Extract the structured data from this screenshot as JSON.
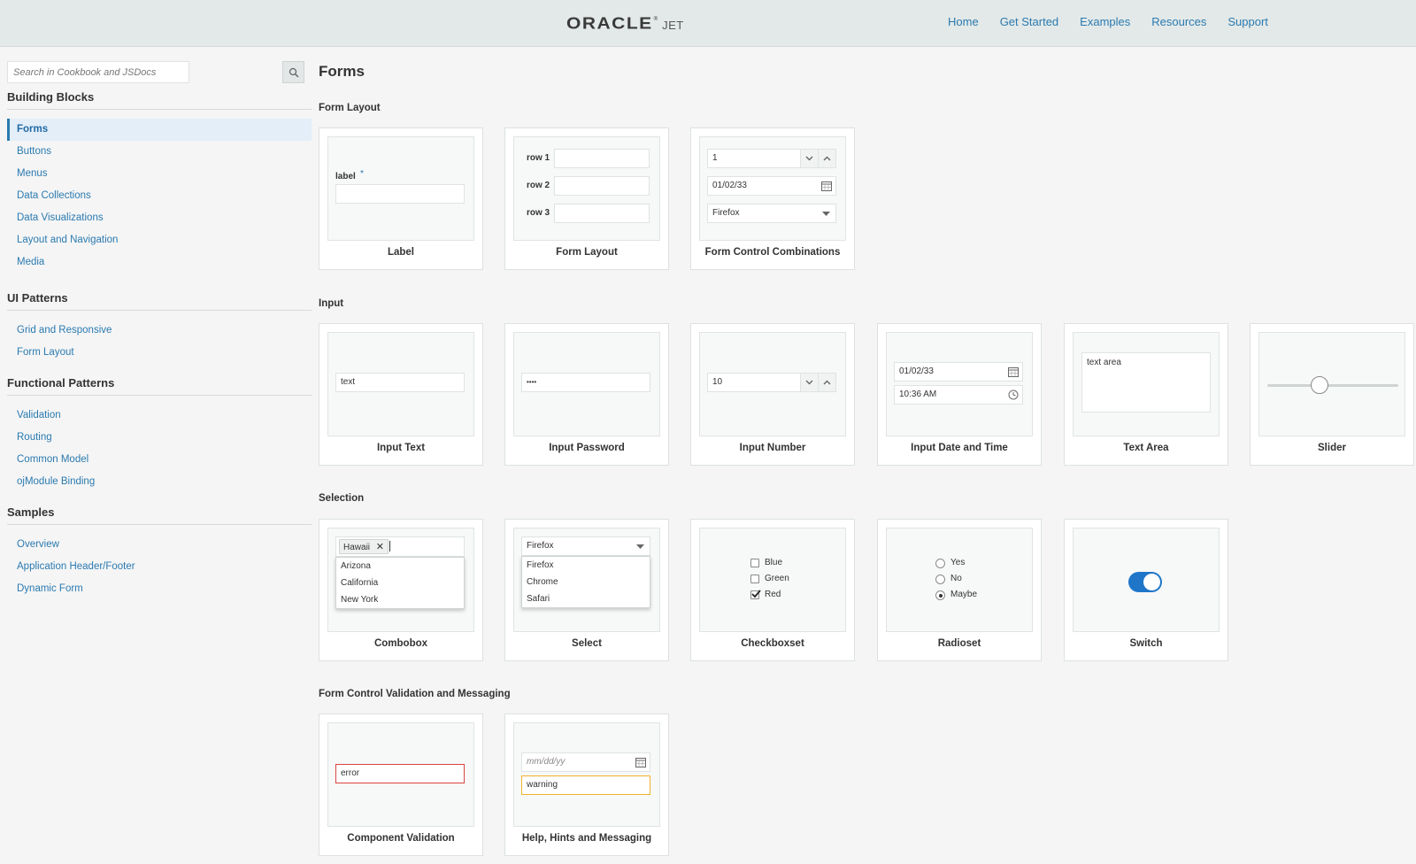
{
  "header": {
    "logo_main": "ORACLE",
    "logo_sub": "JET",
    "logo_reg": "®",
    "nav": [
      "Home",
      "Get Started",
      "Examples",
      "Resources",
      "Support"
    ]
  },
  "sidebar": {
    "search_placeholder": "Search in Cookbook and JSDocs",
    "groups": [
      {
        "title": "Building Blocks",
        "items": [
          "Forms",
          "Buttons",
          "Menus",
          "Data Collections",
          "Data Visualizations",
          "Layout and Navigation",
          "Media"
        ]
      },
      {
        "title": "UI Patterns",
        "items": [
          "Grid and Responsive",
          "Form Layout"
        ]
      },
      {
        "title": "Functional Patterns",
        "items": [
          "Validation",
          "Routing",
          "Common Model",
          "ojModule Binding"
        ]
      },
      {
        "title": "Samples",
        "items": [
          "Overview",
          "Application Header/Footer",
          "Dynamic Form"
        ]
      }
    ],
    "active_item": "Forms"
  },
  "main": {
    "title": "Forms",
    "sections": {
      "form_layout": "Form Layout",
      "input": "Input",
      "selection": "Selection",
      "validation": "Form Control Validation and Messaging"
    },
    "cards": {
      "label": {
        "title": "Label",
        "label_text": "label",
        "required_mark": "*"
      },
      "form_layout": {
        "title": "Form Layout",
        "rows": [
          "row 1",
          "row 2",
          "row 3"
        ]
      },
      "combinations": {
        "title": "Form Control Combinations",
        "number": "1",
        "date": "01/02/33",
        "select": "Firefox"
      },
      "input_text": {
        "title": "Input Text",
        "value": "text"
      },
      "input_password": {
        "title": "Input Password",
        "value": "••••"
      },
      "input_number": {
        "title": "Input Number",
        "value": "10"
      },
      "input_datetime": {
        "title": "Input Date and Time",
        "date": "01/02/33",
        "time": "10:36 AM"
      },
      "text_area": {
        "title": "Text Area",
        "value": "text area"
      },
      "slider": {
        "title": "Slider",
        "value_fraction": 0.4
      },
      "combobox": {
        "title": "Combobox",
        "chip": "Hawaii",
        "options": [
          "Arizona",
          "California",
          "New York"
        ]
      },
      "select": {
        "title": "Select",
        "value": "Firefox",
        "options": [
          "Firefox",
          "Chrome",
          "Safari"
        ]
      },
      "checkboxset": {
        "title": "Checkboxset",
        "options": [
          "Blue",
          "Green",
          "Red"
        ],
        "checked": [
          "Red"
        ]
      },
      "radioset": {
        "title": "Radioset",
        "options": [
          "Yes",
          "No",
          "Maybe"
        ],
        "selected": "Maybe"
      },
      "switch": {
        "title": "Switch",
        "on": true
      },
      "component_validation": {
        "title": "Component Validation",
        "value": "error"
      },
      "help_hints": {
        "title": "Help, Hints and Messaging",
        "placeholder": "mm/dd/yy",
        "value": "warning"
      }
    }
  },
  "colors": {
    "link": "#2a7ab0",
    "header_bg": "#e3e9e8",
    "switch_on": "#1f76c9",
    "error": "#d9443e",
    "warning": "#f2b130"
  }
}
